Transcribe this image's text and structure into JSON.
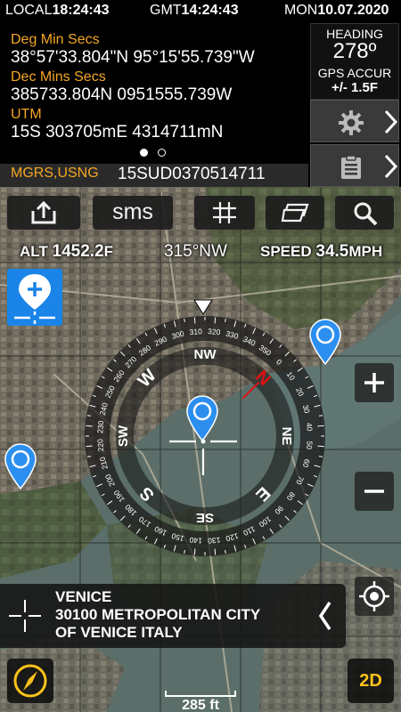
{
  "status": {
    "local_label": "LOCAL",
    "local_time": "18:24:43",
    "gmt_label": "GMT",
    "gmt_time": "14:24:43",
    "day": "MON",
    "date": "10.07.2020"
  },
  "coords": {
    "dms_label": "Deg Min Secs",
    "dms_value": "38°57'33.804\"N 95°15'55.739\"W",
    "dm_label": "Dec Mins Secs",
    "dm_value": "385733.804N   0951555.739W",
    "utm_label": "UTM",
    "utm_value": "15S 303705mE    4314711mN",
    "mgrs_label": "MGRS,USNG",
    "mgrs_value": "15SUD0370514711"
  },
  "pager": {
    "pages": 2,
    "active": 0
  },
  "heading_panel": {
    "heading_label": "HEADING",
    "heading_value": "278º",
    "gps_label": "GPS ACCUR",
    "gps_value": "+/- 1.5F"
  },
  "toolbar": {
    "sms_label": "sms"
  },
  "readouts": {
    "alt_label": "ALT",
    "alt_value": "1452.2",
    "alt_unit": "F",
    "bearing": "315°NW",
    "speed_label": "SPEED",
    "speed_value": "34.5",
    "speed_unit": "MPH"
  },
  "compass": {
    "cardinals": [
      {
        "label": "N",
        "deg": 0
      },
      {
        "label": "NE",
        "deg": 45
      },
      {
        "label": "E",
        "deg": 90
      },
      {
        "label": "SE",
        "deg": 135
      },
      {
        "label": "S",
        "deg": 180
      },
      {
        "label": "SW",
        "deg": 225
      },
      {
        "label": "W",
        "deg": 270
      },
      {
        "label": "NW",
        "deg": 315
      }
    ],
    "heading_deg": 315
  },
  "address": {
    "line1": "VENICE",
    "line2": "30100 METROPOLITAN CITY",
    "line3": "OF VENICE   ITALY"
  },
  "scale": {
    "label": "285 ft"
  },
  "map_mode": {
    "label": "2D"
  },
  "colors": {
    "accent": "#f5a623",
    "pin": "#2c8ff0",
    "locate": "#1a84e8",
    "mode_text": "#ffc21a",
    "north": "#e01010"
  }
}
